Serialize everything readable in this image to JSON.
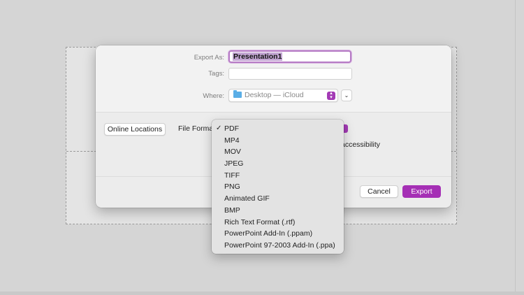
{
  "export_dialog": {
    "export_as_label": "Export As:",
    "file_name": "Presentation1",
    "tags_label": "Tags:",
    "where_label": "Where:",
    "where_value": "Desktop — iCloud",
    "online_locations_label": "Online Locations",
    "file_format_label": "File Format",
    "accessibility_text": "accessibility",
    "cancel_label": "Cancel",
    "export_label": "Export",
    "accent_color": "#a52fb5"
  },
  "format_menu": {
    "selected": "PDF",
    "items": [
      "PDF",
      "MP4",
      "MOV",
      "JPEG",
      "TIFF",
      "PNG",
      "Animated GIF",
      "BMP",
      "Rich Text Format (.rtf)",
      "PowerPoint Add-In (.ppam)",
      "PowerPoint 97-2003 Add-In (.ppa)"
    ]
  }
}
